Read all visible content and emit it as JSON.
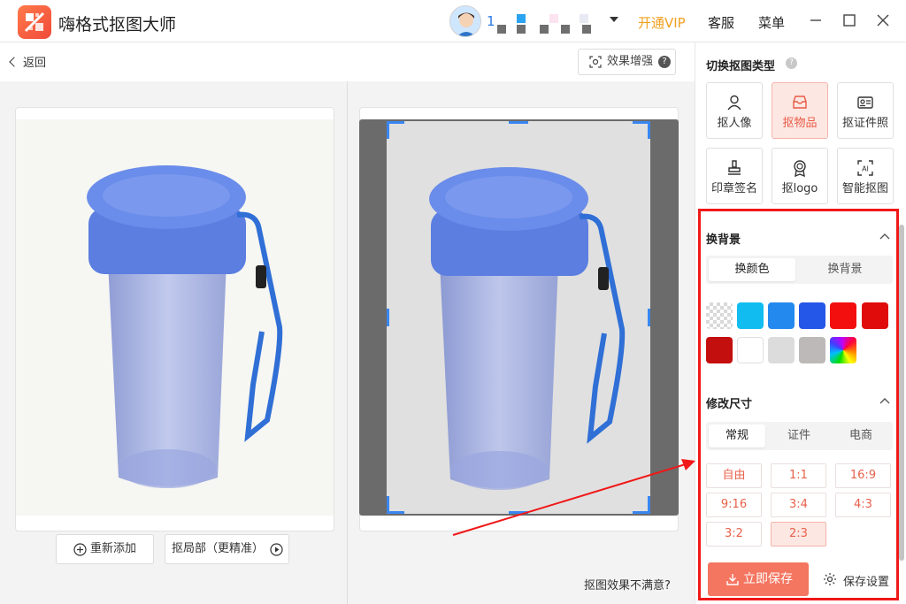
{
  "app": {
    "title": "嗨格式抠图大师",
    "user_id": "1"
  },
  "header": {
    "vip_label": "开通VIP",
    "service_label": "客服",
    "menu_label": "菜单"
  },
  "toolbar": {
    "back_label": "返回",
    "enhance_label": "效果增强",
    "enhance_help": "?"
  },
  "canvas": {
    "readd_label": "重新添加",
    "partial_label": "抠局部（更精准）",
    "unsatisfied_label": "抠图效果不满意?"
  },
  "panel": {
    "type_title": "切换抠图类型",
    "help": "?",
    "types": [
      {
        "label": "抠人像",
        "icon": "person-icon"
      },
      {
        "label": "抠物品",
        "icon": "box-icon",
        "active": true
      },
      {
        "label": "抠证件照",
        "icon": "id-card-icon"
      },
      {
        "label": "印章签名",
        "icon": "stamp-icon"
      },
      {
        "label": "抠logo",
        "icon": "badge-icon"
      },
      {
        "label": "智能抠图",
        "icon": "ai-icon"
      }
    ],
    "background": {
      "title": "换背景",
      "tabs": [
        "换颜色",
        "换背景"
      ],
      "active_tab": 0,
      "swatches": [
        "transparent",
        "#11bdf0",
        "#2489ee",
        "#2456e8",
        "#f40f0f",
        "#e00b0b",
        "#c40f0f",
        "#ffffff",
        "#dcdcdc",
        "#bdb9b9",
        "gradient"
      ]
    },
    "size": {
      "title": "修改尺寸",
      "tabs": [
        "常规",
        "证件",
        "电商"
      ],
      "active_tab": 0,
      "ratios": [
        "自由",
        "1:1",
        "16:9",
        "9:16",
        "3:4",
        "4:3",
        "3:2",
        "2:3"
      ],
      "active_ratio": "2:3"
    },
    "save_now_label": "立即保存",
    "save_settings_label": "保存设置"
  },
  "colors": {
    "accent": "#f47560",
    "vip": "#f0a020",
    "highlight": "#f01818",
    "handle": "#3a86f0"
  }
}
